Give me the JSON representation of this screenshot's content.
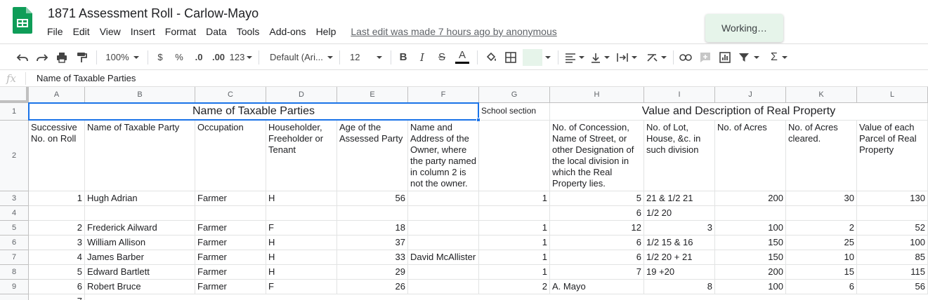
{
  "app": {
    "doc_title": "1871 Assessment Roll - Carlow-Mayo",
    "last_edit": "Last edit was made 7 hours ago by anonymous",
    "status_toast": "Working…",
    "menus": [
      "File",
      "Edit",
      "View",
      "Insert",
      "Format",
      "Data",
      "Tools",
      "Add-ons",
      "Help"
    ]
  },
  "toolbar": {
    "zoom": "100%",
    "currency": "$",
    "percent": "%",
    "decrease_decimal": ".0",
    "increase_decimal": ".00",
    "more_formats": "123",
    "font": "Default (Ari...",
    "font_size": "12",
    "bold": "B",
    "italic": "I",
    "strike": "S",
    "text_color_glyph": "A",
    "function_glyph": "Σ"
  },
  "formula_bar": {
    "fx": "fx",
    "value": "Name of Taxable Parties"
  },
  "columns": [
    "A",
    "B",
    "C",
    "D",
    "E",
    "F",
    "G",
    "H",
    "I",
    "J",
    "K",
    "L"
  ],
  "row_numbers": [
    "1",
    "2",
    "3",
    "4",
    "5",
    "6",
    "7",
    "8",
    "9"
  ],
  "row1": {
    "taxable_parties": "Name of Taxable Parties",
    "school_section": "School section",
    "real_property": "Value and Description of Real Property"
  },
  "row2": [
    "Successive No. on Roll",
    "Name of Taxable Party",
    "Occupation",
    "Householder, Freeholder or Tenant",
    "Age of the Assessed Party",
    "Name and Address of the Owner, where the party named in column 2 is not the owner.",
    "",
    "No. of Concession, Name of Street, or other Designation of the local division in which the Real Property lies.",
    "No. of Lot, House, &c. in such division",
    "No. of Acres",
    "No. of Acres cleared.",
    "Value of each Parcel of Real Property"
  ],
  "rows": [
    [
      "1",
      "Hugh Adrian",
      "Farmer",
      "H",
      "56",
      "",
      "1",
      "5",
      "21 & 1/2 21",
      "200",
      "30",
      "130"
    ],
    [
      "",
      "",
      "",
      "",
      "",
      "",
      "",
      "6",
      "1/2 20",
      "",
      "",
      ""
    ],
    [
      "2",
      "Frederick Ailward",
      "Farmer",
      "F",
      "18",
      "",
      "1",
      "12",
      "3",
      "100",
      "2",
      "52"
    ],
    [
      "3",
      "William Allison",
      "Farmer",
      "H",
      "37",
      "",
      "1",
      "6",
      "1/2 15 & 16",
      "150",
      "25",
      "100"
    ],
    [
      "4",
      "James Barber",
      "Farmer",
      "H",
      "33",
      "David McAllister",
      "1",
      "6",
      "1/2 20 + 21",
      "150",
      "10",
      "85"
    ],
    [
      "5",
      "Edward Bartlett",
      "Farmer",
      "H",
      "29",
      "",
      "1",
      "7",
      "19 +20",
      "200",
      "15",
      "115"
    ],
    [
      "6",
      "Robert Bruce",
      "Farmer",
      "F",
      "26",
      "",
      "2",
      "A. Mayo",
      "8",
      "100",
      "6",
      "56"
    ]
  ],
  "next_row_peek": "7"
}
